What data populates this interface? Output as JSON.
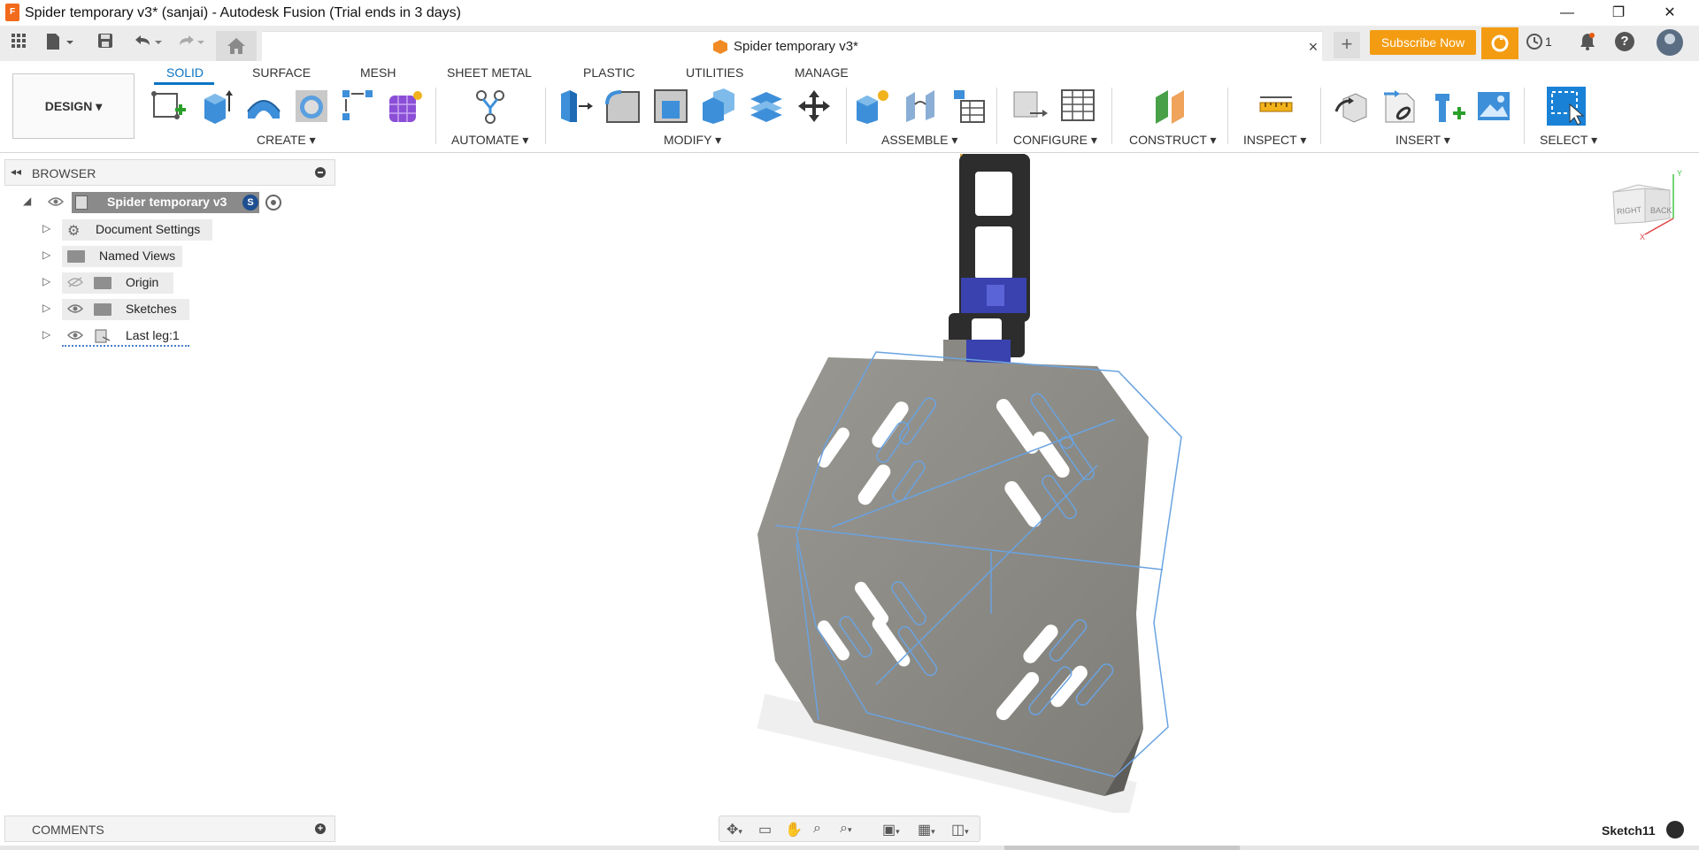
{
  "window": {
    "title": "Spider temporary v3* (sanjai) - Autodesk Fusion (Trial ends in 3 days)",
    "app_icon_letter": "F",
    "minimize_glyph": "—",
    "restore_glyph": "❐",
    "close_glyph": "✕"
  },
  "document_tab": {
    "label": "Spider temporary v3*",
    "close_glyph": "×"
  },
  "header": {
    "new_tab_glyph": "+",
    "subscribe_label": "Subscribe Now",
    "jobs_count": "1"
  },
  "workspace": {
    "label": "DESIGN ▾"
  },
  "ribbon_tabs": [
    "SOLID",
    "SURFACE",
    "MESH",
    "SHEET METAL",
    "PLASTIC",
    "UTILITIES",
    "MANAGE"
  ],
  "ribbon_groups": {
    "create": "CREATE ▾",
    "automate": "AUTOMATE ▾",
    "modify": "MODIFY ▾",
    "assemble": "ASSEMBLE ▾",
    "configure": "CONFIGURE ▾",
    "construct": "CONSTRUCT ▾",
    "inspect": "INSPECT ▾",
    "insert": "INSERT ▾",
    "select": "SELECT ▾"
  },
  "browser": {
    "title": "BROWSER",
    "root": "Spider temporary v3",
    "items": [
      "Document Settings",
      "Named Views",
      "Origin",
      "Sketches",
      "Last leg:1"
    ]
  },
  "comments": {
    "title": "COMMENTS"
  },
  "viewcube": {
    "right": "RIGHT",
    "back": "BACK",
    "axis_y": "Y",
    "axis_x": "X"
  },
  "status": {
    "active_sketch": "Sketch11"
  },
  "colors": {
    "accent": "#0a73c4",
    "subscribe": "#f39c12",
    "plate": "#8d8b86",
    "sketch_lines": "#6aa3e0"
  }
}
